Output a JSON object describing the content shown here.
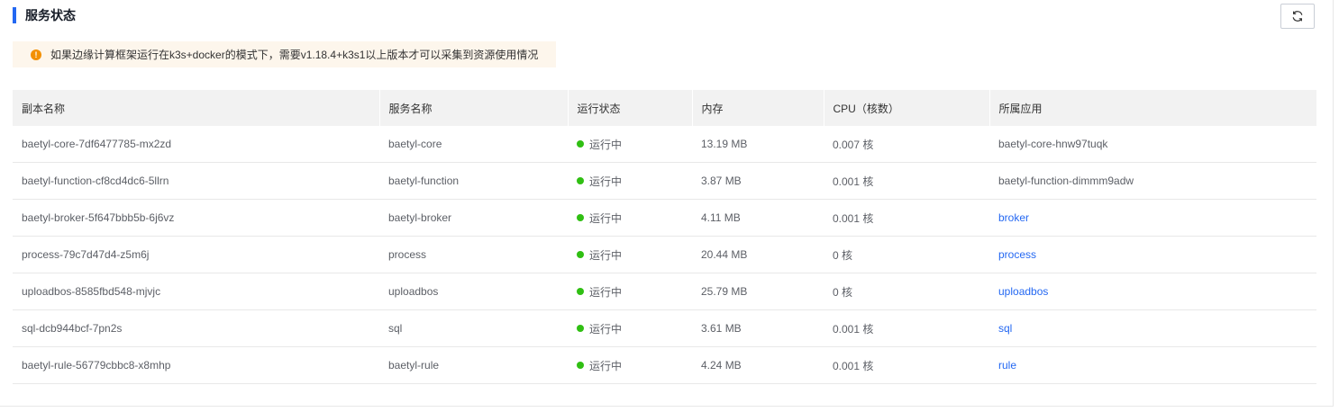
{
  "section": {
    "title": "服务状态"
  },
  "notice": {
    "icon": "warning-icon",
    "text": "如果边缘计算框架运行在k3s+docker的模式下，需要v1.18.4+k3s1以上版本才可以采集到资源使用情况"
  },
  "table": {
    "columns": [
      "副本名称",
      "服务名称",
      "运行状态",
      "内存",
      "CPU（核数）",
      "所属应用"
    ],
    "rows": [
      {
        "replica": "baetyl-core-7df6477785-mx2zd",
        "service": "baetyl-core",
        "status": "运行中",
        "memory": "13.19 MB",
        "cpu": "0.007 核",
        "app": "baetyl-core-hnw97tuqk",
        "app_link": false
      },
      {
        "replica": "baetyl-function-cf8cd4dc6-5llrn",
        "service": "baetyl-function",
        "status": "运行中",
        "memory": "3.87 MB",
        "cpu": "0.001 核",
        "app": "baetyl-function-dimmm9adw",
        "app_link": false
      },
      {
        "replica": "baetyl-broker-5f647bbb5b-6j6vz",
        "service": "baetyl-broker",
        "status": "运行中",
        "memory": "4.11 MB",
        "cpu": "0.001 核",
        "app": "broker",
        "app_link": true
      },
      {
        "replica": "process-79c7d47d4-z5m6j",
        "service": "process",
        "status": "运行中",
        "memory": "20.44 MB",
        "cpu": "0 核",
        "app": "process",
        "app_link": true
      },
      {
        "replica": "uploadbos-8585fbd548-mjvjc",
        "service": "uploadbos",
        "status": "运行中",
        "memory": "25.79 MB",
        "cpu": "0 核",
        "app": "uploadbos",
        "app_link": true
      },
      {
        "replica": "sql-dcb944bcf-7pn2s",
        "service": "sql",
        "status": "运行中",
        "memory": "3.61 MB",
        "cpu": "0.001 核",
        "app": "sql",
        "app_link": true
      },
      {
        "replica": "baetyl-rule-56779cbbc8-x8mhp",
        "service": "baetyl-rule",
        "status": "运行中",
        "memory": "4.24 MB",
        "cpu": "0.001 核",
        "app": "rule",
        "app_link": true
      }
    ]
  },
  "colors": {
    "accent": "#2468f2",
    "status_running": "#30bf13",
    "warning": "#f39000"
  }
}
